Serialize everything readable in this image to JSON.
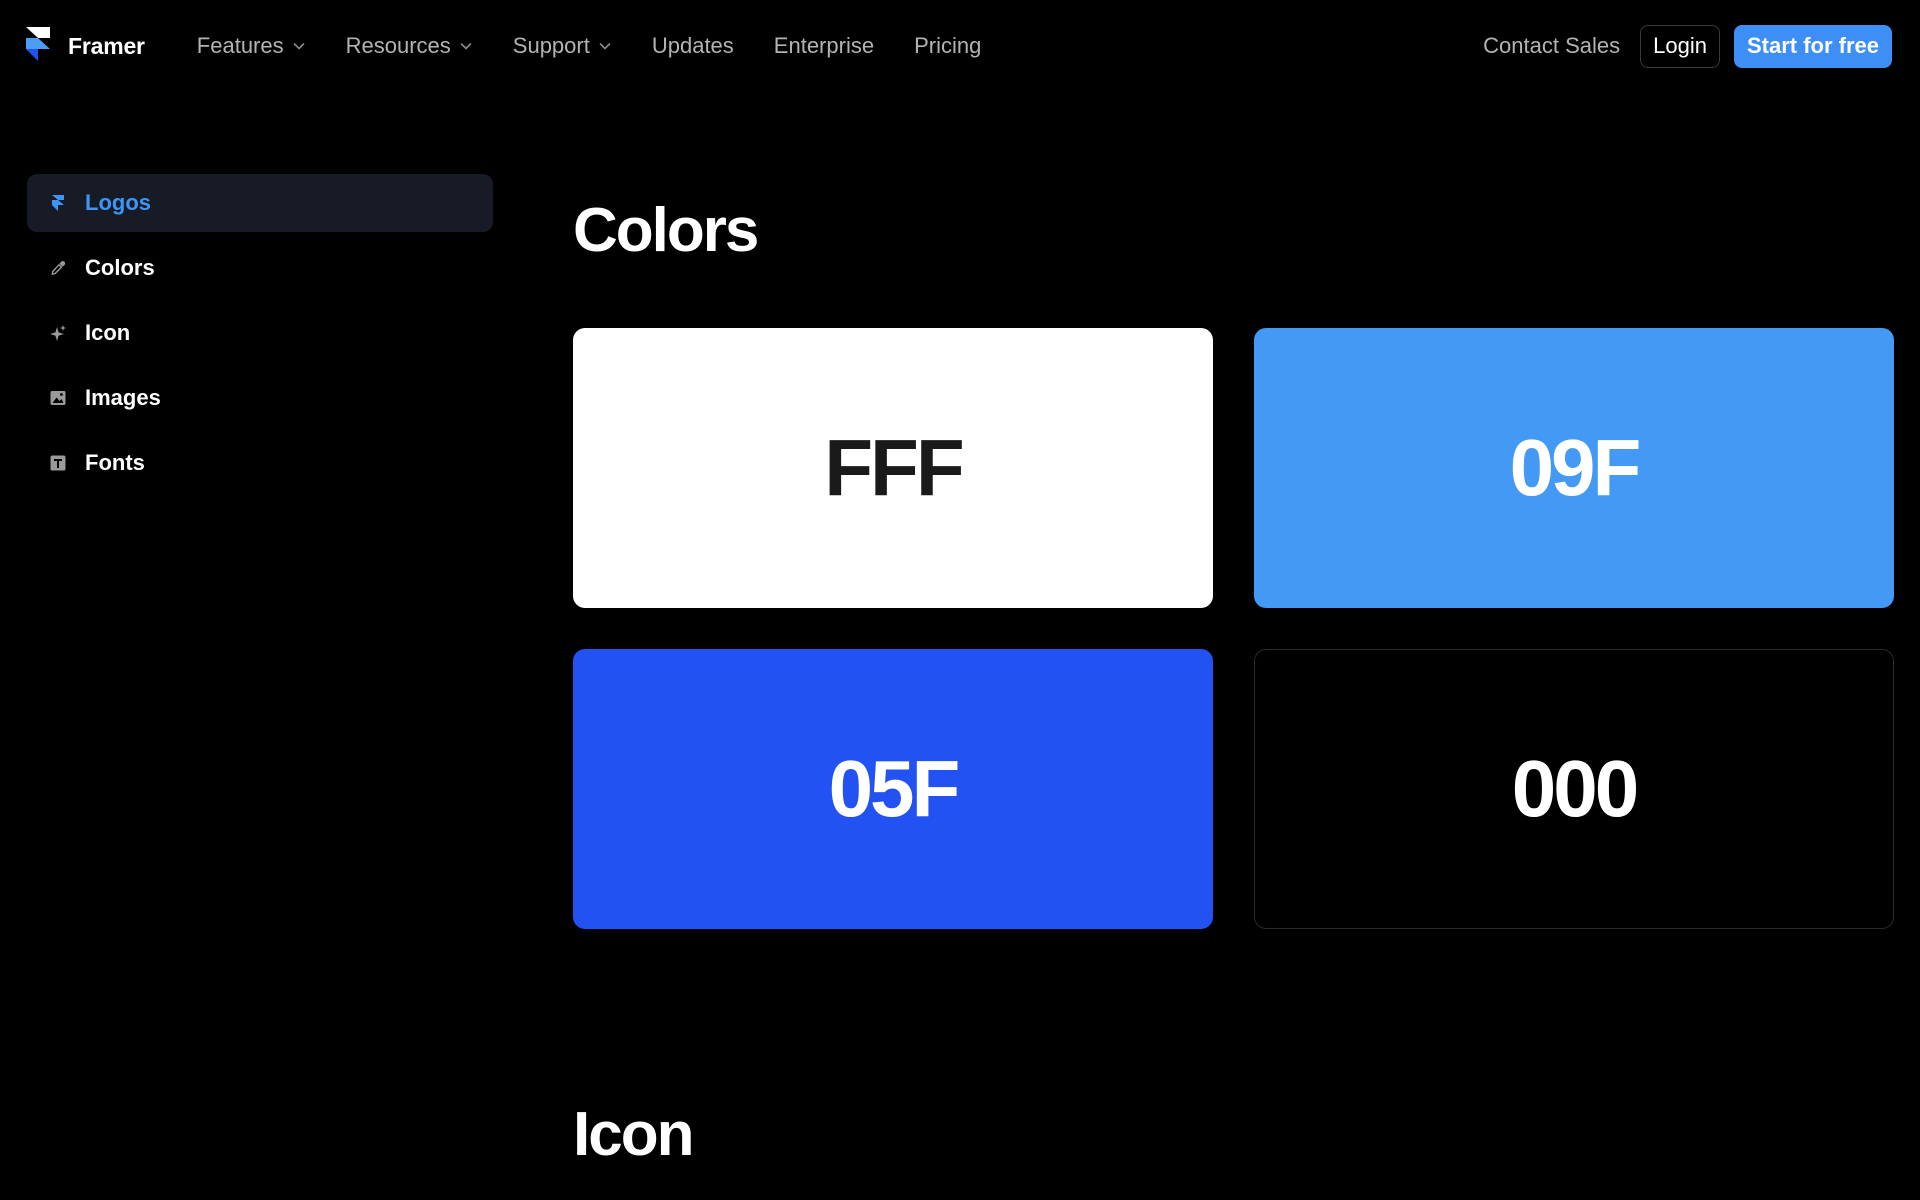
{
  "header": {
    "brand": "Framer",
    "nav": [
      {
        "label": "Features",
        "dropdown": true
      },
      {
        "label": "Resources",
        "dropdown": true
      },
      {
        "label": "Support",
        "dropdown": true
      },
      {
        "label": "Updates",
        "dropdown": false
      },
      {
        "label": "Enterprise",
        "dropdown": false
      },
      {
        "label": "Pricing",
        "dropdown": false
      }
    ],
    "contact_label": "Contact Sales",
    "login_label": "Login",
    "start_label": "Start for free"
  },
  "sidebar": {
    "items": [
      {
        "label": "Logos",
        "icon": "framer-logo-icon",
        "active": true
      },
      {
        "label": "Colors",
        "icon": "eyedropper-icon",
        "active": false
      },
      {
        "label": "Icon",
        "icon": "sparkle-icon",
        "active": false
      },
      {
        "label": "Images",
        "icon": "image-icon",
        "active": false
      },
      {
        "label": "Fonts",
        "icon": "text-icon",
        "active": false
      }
    ]
  },
  "main": {
    "colors_title": "Colors",
    "swatches": [
      {
        "label": "FFF",
        "bg": "#FFFFFF",
        "fg": "#1a1a1a"
      },
      {
        "label": "09F",
        "bg": "#4499F5",
        "fg": "#FFFFFF"
      },
      {
        "label": "05F",
        "bg": "#2352F2",
        "fg": "#FFFFFF"
      },
      {
        "label": "000",
        "bg": "#000000",
        "fg": "#FFFFFF",
        "border": "#2a2a2a"
      }
    ],
    "icon_title": "Icon"
  },
  "colors": {
    "accent": "#3D8FF5",
    "active_item_text": "#3D96F5",
    "active_item_bg": "#161B26",
    "nav_text": "#B3B3B3"
  }
}
